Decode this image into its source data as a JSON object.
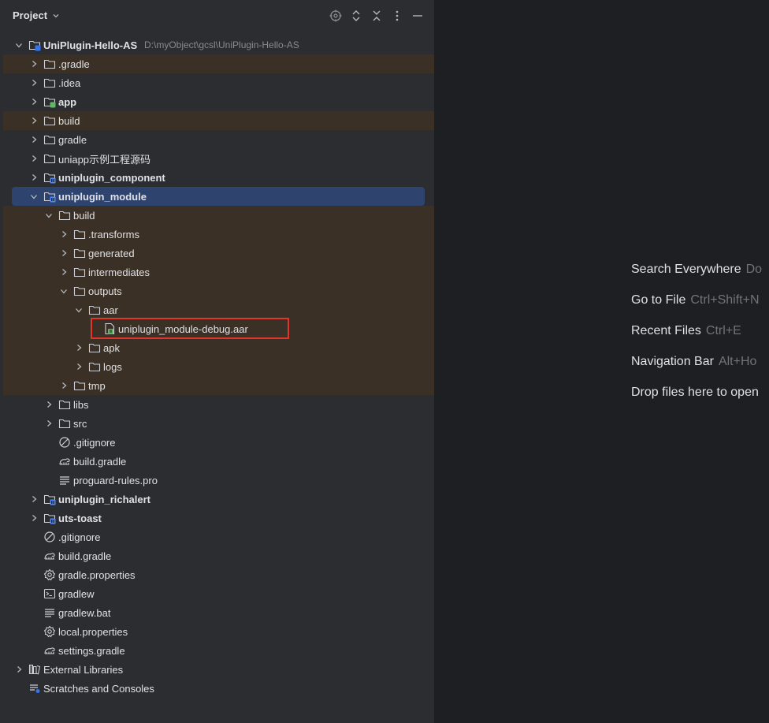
{
  "panel": {
    "title": "Project"
  },
  "tree": [
    {
      "label": "UniPlugin-Hello-AS",
      "path": "D:\\myObject\\gcsl\\UniPlugin-Hello-AS",
      "bold": true,
      "icon": "module-folder-icon",
      "arrow": "down",
      "depth": 0,
      "state": "normal"
    },
    {
      "label": ".gradle",
      "icon": "folder-icon",
      "arrow": "right",
      "depth": 1,
      "state": "excluded"
    },
    {
      "label": ".idea",
      "icon": "folder-icon",
      "arrow": "right",
      "depth": 1,
      "state": "normal"
    },
    {
      "label": "app",
      "bold": true,
      "icon": "android-module-icon",
      "arrow": "right",
      "depth": 1,
      "state": "normal"
    },
    {
      "label": "build",
      "icon": "folder-icon",
      "arrow": "right",
      "depth": 1,
      "state": "excluded"
    },
    {
      "label": "gradle",
      "icon": "folder-icon",
      "arrow": "right",
      "depth": 1,
      "state": "normal"
    },
    {
      "label": "uniapp示例工程源码",
      "icon": "folder-icon",
      "arrow": "right",
      "depth": 1,
      "state": "normal"
    },
    {
      "label": "uniplugin_component",
      "bold": true,
      "icon": "library-module-icon",
      "arrow": "right",
      "depth": 1,
      "state": "normal"
    },
    {
      "label": "uniplugin_module",
      "bold": true,
      "icon": "library-module-icon",
      "arrow": "down",
      "depth": 1,
      "state": "selected"
    },
    {
      "label": "build",
      "icon": "folder-icon",
      "arrow": "down",
      "depth": 2,
      "state": "excluded"
    },
    {
      "label": ".transforms",
      "icon": "folder-icon",
      "arrow": "right",
      "depth": 3,
      "state": "excluded"
    },
    {
      "label": "generated",
      "icon": "folder-icon",
      "arrow": "right",
      "depth": 3,
      "state": "excluded"
    },
    {
      "label": "intermediates",
      "icon": "folder-icon",
      "arrow": "right",
      "depth": 3,
      "state": "excluded"
    },
    {
      "label": "outputs",
      "icon": "folder-icon",
      "arrow": "down",
      "depth": 3,
      "state": "excluded"
    },
    {
      "label": "aar",
      "icon": "folder-icon",
      "arrow": "down",
      "depth": 4,
      "state": "excluded"
    },
    {
      "label": "uniplugin_module-debug.aar",
      "icon": "archive-file-icon",
      "arrow": "none",
      "depth": 5,
      "state": "excluded"
    },
    {
      "label": "apk",
      "icon": "folder-icon",
      "arrow": "right",
      "depth": 4,
      "state": "excluded"
    },
    {
      "label": "logs",
      "icon": "folder-icon",
      "arrow": "right",
      "depth": 4,
      "state": "excluded"
    },
    {
      "label": "tmp",
      "icon": "folder-icon",
      "arrow": "right",
      "depth": 3,
      "state": "excluded"
    },
    {
      "label": "libs",
      "icon": "folder-icon",
      "arrow": "right",
      "depth": 2,
      "state": "normal"
    },
    {
      "label": "src",
      "icon": "folder-icon",
      "arrow": "right",
      "depth": 2,
      "state": "normal"
    },
    {
      "label": ".gitignore",
      "icon": "ignore-file-icon",
      "arrow": "none",
      "depth": 2,
      "state": "normal"
    },
    {
      "label": "build.gradle",
      "icon": "gradle-icon",
      "arrow": "none",
      "depth": 2,
      "state": "normal"
    },
    {
      "label": "proguard-rules.pro",
      "icon": "text-file-icon",
      "arrow": "none",
      "depth": 2,
      "state": "normal"
    },
    {
      "label": "uniplugin_richalert",
      "bold": true,
      "icon": "library-module-icon",
      "arrow": "right",
      "depth": 1,
      "state": "normal"
    },
    {
      "label": "uts-toast",
      "bold": true,
      "icon": "library-module-icon",
      "arrow": "right",
      "depth": 1,
      "state": "normal"
    },
    {
      "label": ".gitignore",
      "icon": "ignore-file-icon",
      "arrow": "none",
      "depth": 1,
      "state": "normal"
    },
    {
      "label": "build.gradle",
      "icon": "gradle-icon",
      "arrow": "none",
      "depth": 1,
      "state": "normal"
    },
    {
      "label": "gradle.properties",
      "icon": "settings-file-icon",
      "arrow": "none",
      "depth": 1,
      "state": "normal"
    },
    {
      "label": "gradlew",
      "icon": "terminal-file-icon",
      "arrow": "none",
      "depth": 1,
      "state": "normal"
    },
    {
      "label": "gradlew.bat",
      "icon": "text-file-icon",
      "arrow": "none",
      "depth": 1,
      "state": "normal"
    },
    {
      "label": "local.properties",
      "icon": "settings-file-icon",
      "arrow": "none",
      "depth": 1,
      "state": "normal"
    },
    {
      "label": "settings.gradle",
      "icon": "gradle-icon",
      "arrow": "none",
      "depth": 1,
      "state": "normal"
    },
    {
      "label": "External Libraries",
      "icon": "libraries-icon",
      "arrow": "right",
      "depth": 0,
      "state": "normal"
    },
    {
      "label": "Scratches and Consoles",
      "icon": "scratches-icon",
      "arrow": "none",
      "depth": 0,
      "state": "normal"
    }
  ],
  "editor_hints": [
    {
      "name": "Search Everywhere",
      "shortcut": "Do"
    },
    {
      "name": "Go to File",
      "shortcut": "Ctrl+Shift+N"
    },
    {
      "name": "Recent Files",
      "shortcut": "Ctrl+E"
    },
    {
      "name": "Navigation Bar",
      "shortcut": "Alt+Ho"
    },
    {
      "name": "Drop files here to open",
      "shortcut": ""
    }
  ],
  "colors": {
    "panel_bg": "#2b2d30",
    "editor_bg": "#1e1f22",
    "excluded_row": "#3b3025",
    "selected_row": "#2e436e",
    "highlight_box": "#e0352d",
    "text": "#dfe1e5",
    "muted": "#868a91"
  }
}
